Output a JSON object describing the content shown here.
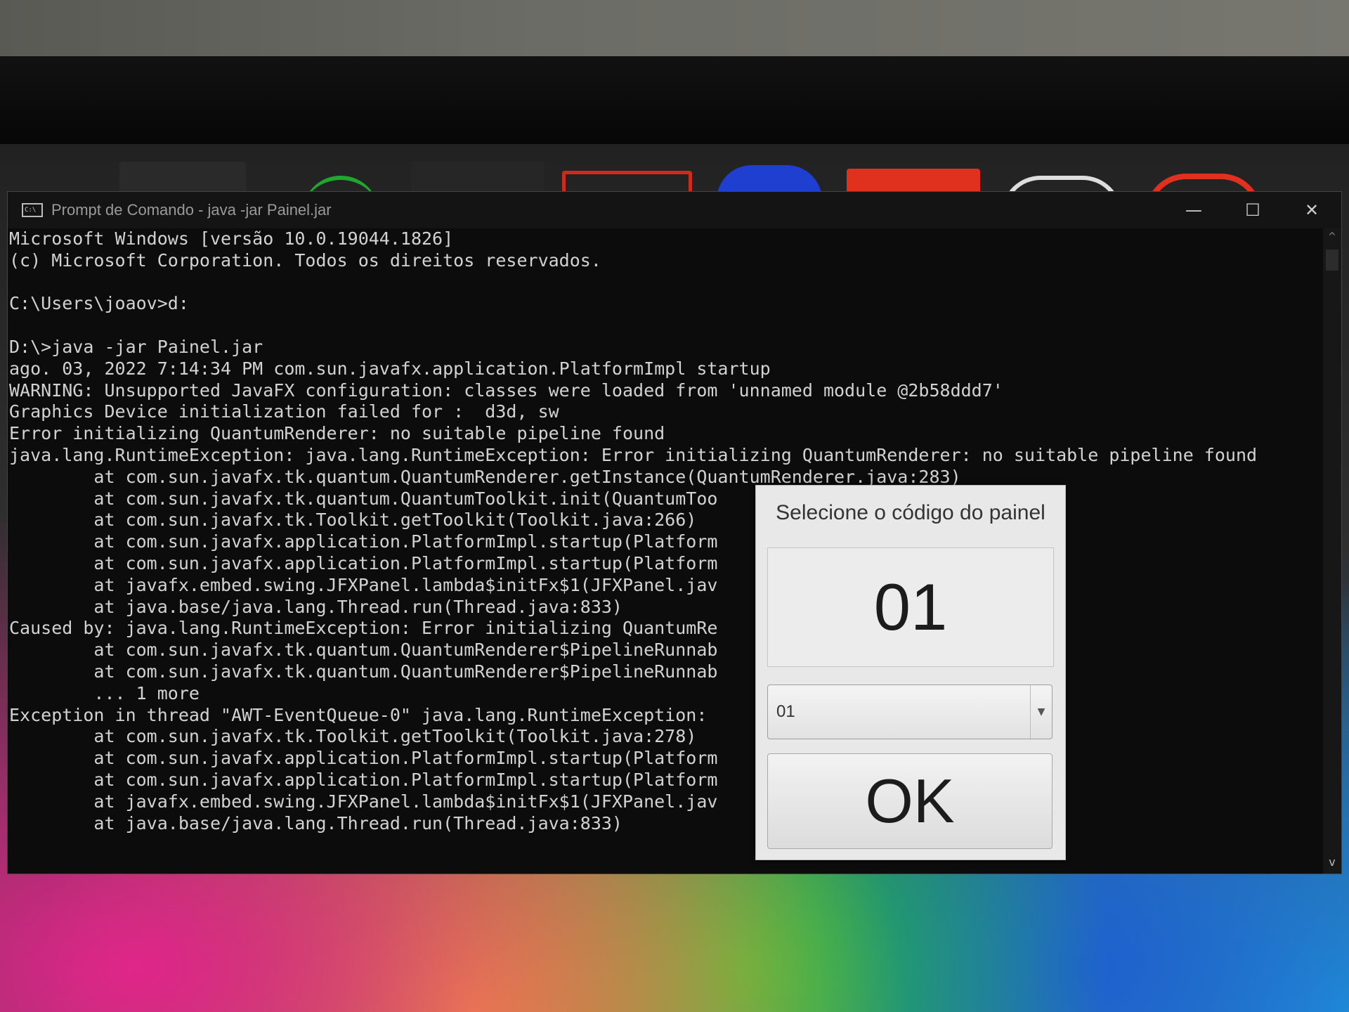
{
  "window": {
    "title": "Prompt de Comando - java -jar Painel.jar",
    "icon": "cmd-icon",
    "controls": {
      "minimize": "—",
      "maximize": "☐",
      "close": "✕"
    }
  },
  "console": {
    "lines": [
      "Microsoft Windows [versão 10.0.19044.1826]",
      "(c) Microsoft Corporation. Todos os direitos reservados.",
      "",
      "C:\\Users\\joaov>d:",
      "",
      "D:\\>java -jar Painel.jar",
      "ago. 03, 2022 7:14:34 PM com.sun.javafx.application.PlatformImpl startup",
      "WARNING: Unsupported JavaFX configuration: classes were loaded from 'unnamed module @2b58ddd7'",
      "Graphics Device initialization failed for :  d3d, sw",
      "Error initializing QuantumRenderer: no suitable pipeline found",
      "java.lang.RuntimeException: java.lang.RuntimeException: Error initializing QuantumRenderer: no suitable pipeline found",
      "        at com.sun.javafx.tk.quantum.QuantumRenderer.getInstance(QuantumRenderer.java:283)",
      "        at com.sun.javafx.tk.quantum.QuantumToolkit.init(QuantumToo",
      "        at com.sun.javafx.tk.Toolkit.getToolkit(Toolkit.java:266)",
      "        at com.sun.javafx.application.PlatformImpl.startup(Platform",
      "        at com.sun.javafx.application.PlatformImpl.startup(Platform",
      "        at javafx.embed.swing.JFXPanel.lambda$initFx$1(JFXPanel.jav",
      "        at java.base/java.lang.Thread.run(Thread.java:833)",
      "Caused by: java.lang.RuntimeException: Error initializing QuantumRe                        found",
      "        at com.sun.javafx.tk.quantum.QuantumRenderer$PipelineRunnab                        :95)",
      "        at com.sun.javafx.tk.quantum.QuantumRenderer$PipelineRunnab                       125)",
      "        ... 1 more",
      "Exception in thread \"AWT-EventQueue-0\" java.lang.RuntimeException:",
      "        at com.sun.javafx.tk.Toolkit.getToolkit(Toolkit.java:278)",
      "        at com.sun.javafx.application.PlatformImpl.startup(Platform",
      "        at com.sun.javafx.application.PlatformImpl.startup(Platform",
      "        at javafx.embed.swing.JFXPanel.lambda$initFx$1(JFXPanel.jav",
      "        at java.base/java.lang.Thread.run(Thread.java:833)"
    ]
  },
  "dialog": {
    "title": "Selecione o código do painel",
    "display_value": "01",
    "select_value": "01",
    "ok_label": "OK"
  },
  "colors": {
    "console_bg": "#0c0c0c",
    "console_text": "#d2d2d2",
    "dialog_bg": "#e8e8e8"
  }
}
